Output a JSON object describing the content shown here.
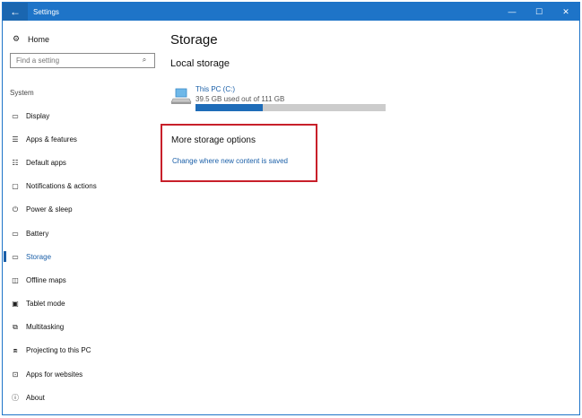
{
  "window": {
    "title": "Settings",
    "controls": {
      "minimize": "—",
      "maximize": "☐",
      "close": "✕"
    },
    "back": "←"
  },
  "sidebar": {
    "home_label": "Home",
    "search_placeholder": "Find a setting",
    "section_label": "System",
    "items": [
      {
        "label": "Display",
        "icon": "monitor-icon"
      },
      {
        "label": "Apps & features",
        "icon": "apps-list-icon"
      },
      {
        "label": "Default apps",
        "icon": "default-apps-icon"
      },
      {
        "label": "Notifications & actions",
        "icon": "notifications-icon"
      },
      {
        "label": "Power & sleep",
        "icon": "power-icon"
      },
      {
        "label": "Battery",
        "icon": "battery-icon"
      },
      {
        "label": "Storage",
        "icon": "storage-icon",
        "active": true
      },
      {
        "label": "Offline maps",
        "icon": "map-icon"
      },
      {
        "label": "Tablet mode",
        "icon": "tablet-icon"
      },
      {
        "label": "Multitasking",
        "icon": "multitasking-icon"
      },
      {
        "label": "Projecting to this PC",
        "icon": "projecting-icon"
      },
      {
        "label": "Apps for websites",
        "icon": "apps-websites-icon"
      },
      {
        "label": "About",
        "icon": "info-icon"
      }
    ]
  },
  "main": {
    "title": "Storage",
    "local_storage_title": "Local storage",
    "drive": {
      "name": "This PC (C:)",
      "usage": "39.5 GB used out of 111 GB",
      "used_fraction": 0.356
    },
    "more_options_title": "More storage options",
    "change_link": "Change where new content is saved"
  },
  "colors": {
    "accent": "#1e74c8",
    "link": "#1a5fa8",
    "highlight_border": "#c8202a"
  }
}
